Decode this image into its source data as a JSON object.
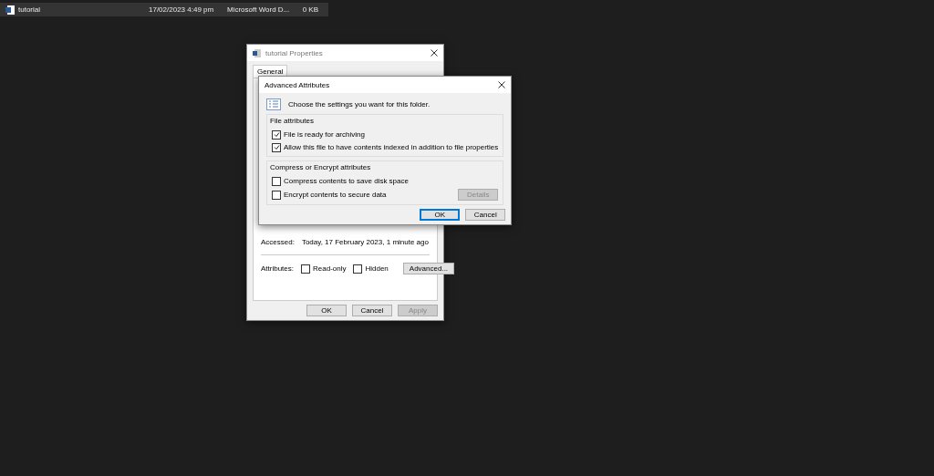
{
  "file_row": {
    "name": "tutorial",
    "modified": "17/02/2023 4:49 pm",
    "type": "Microsoft Word D...",
    "size": "0 KB",
    "selected": true
  },
  "properties": {
    "title": "tutorial Properties",
    "tabs": [
      {
        "label": "General",
        "selected": true
      }
    ],
    "accessed": {
      "label": "Accessed:",
      "value": "Today, 17 February 2023, 1 minute ago"
    },
    "attributes": {
      "label": "Attributes:",
      "options": [
        {
          "label": "Read-only",
          "checked": false
        },
        {
          "label": "Hidden",
          "checked": false
        }
      ],
      "advanced_button": "Advanced..."
    },
    "buttons": [
      {
        "label": "OK",
        "disabled": false
      },
      {
        "label": "Cancel",
        "disabled": false
      },
      {
        "label": "Apply",
        "disabled": true
      }
    ]
  },
  "advanced": {
    "title": "Advanced Attributes",
    "description": "Choose the settings you want for this folder.",
    "groups": [
      {
        "title": "File attributes",
        "options": [
          {
            "label": "File is ready for archiving",
            "checked": true
          },
          {
            "label": "Allow this file to have contents indexed in addition to file properties",
            "checked": true
          }
        ]
      },
      {
        "title": "Compress or Encrypt attributes",
        "options": [
          {
            "label": "Compress contents to save disk space",
            "checked": false
          },
          {
            "label": "Encrypt contents to secure data",
            "checked": false
          }
        ],
        "details_button": {
          "label": "Details",
          "disabled": true
        }
      }
    ],
    "buttons": [
      {
        "label": "OK",
        "default": true
      },
      {
        "label": "Cancel",
        "default": false
      }
    ]
  }
}
